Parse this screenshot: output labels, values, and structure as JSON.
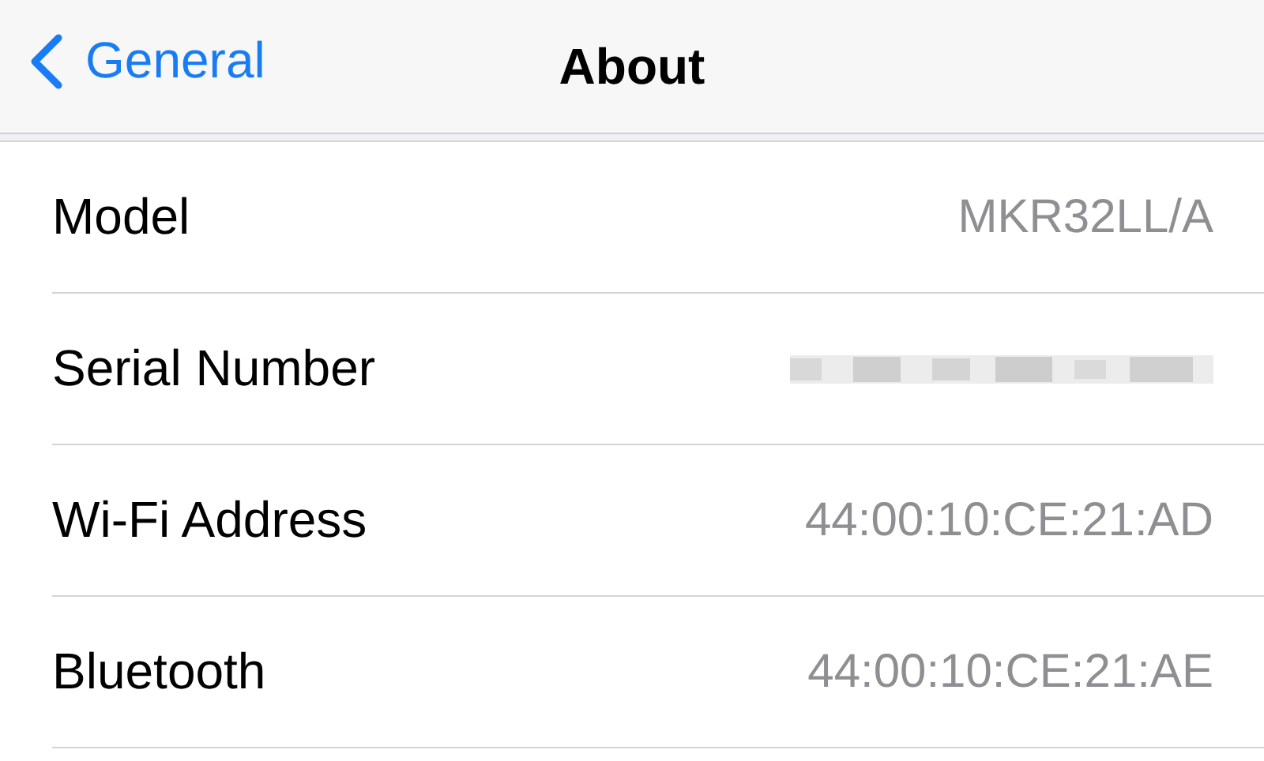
{
  "nav": {
    "back": "General",
    "title": "About"
  },
  "rows": [
    {
      "label": "Model",
      "kind": "text",
      "value": "MKR32LL/A"
    },
    {
      "label": "Serial Number",
      "kind": "redacted"
    },
    {
      "label": "Wi-Fi Address",
      "kind": "text",
      "value": "44:00:10:CE:21:AD"
    },
    {
      "label": "Bluetooth",
      "kind": "text",
      "value": "44:00:10:CE:21:AE"
    }
  ]
}
